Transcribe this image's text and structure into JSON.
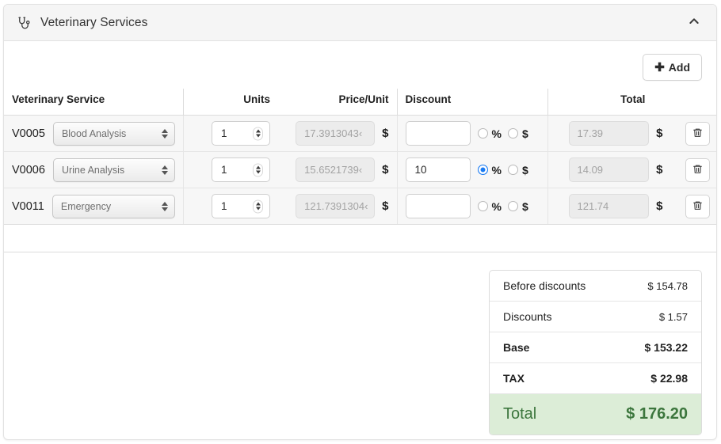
{
  "card": {
    "title": "Veterinary Services",
    "icon": "stethoscope-icon",
    "collapse_icon": "chevron-up-icon"
  },
  "toolbar": {
    "add_label": "Add",
    "add_icon": "plus-icon"
  },
  "table": {
    "headers": {
      "service": "Veterinary Service",
      "units": "Units",
      "price": "Price/Unit",
      "discount": "Discount",
      "total": "Total"
    },
    "currency_symbol": "$",
    "percent_symbol": "%",
    "delete_icon": "trash-icon",
    "rows": [
      {
        "code": "V0005",
        "service": "Blood Analysis",
        "units": "1",
        "price": "17.3913043478261",
        "price_display": "17.3913043‹",
        "discount_value": "",
        "discount_mode": "none",
        "total": "17.39"
      },
      {
        "code": "V0006",
        "service": "Urine Analysis",
        "units": "1",
        "price": "15.6521739130435",
        "price_display": "15.6521739‹",
        "discount_value": "10",
        "discount_mode": "percent",
        "total": "14.09"
      },
      {
        "code": "V0011",
        "service": "Emergency",
        "units": "1",
        "price": "121.739130434783",
        "price_display": "121.7391304‹",
        "discount_value": "",
        "discount_mode": "none",
        "total": "121.74"
      }
    ]
  },
  "summary": {
    "rows": [
      {
        "label": "Before discounts",
        "value": "$ 154.78",
        "strong": false
      },
      {
        "label": "Discounts",
        "value": "$ 1.57",
        "strong": false
      },
      {
        "label": "Base",
        "value": "$ 153.22",
        "strong": true
      },
      {
        "label": "TAX",
        "value": "$ 22.98",
        "strong": true
      }
    ],
    "grand": {
      "label": "Total",
      "value": "$ 176.20"
    }
  },
  "colors": {
    "accent_radio": "#1a7bf2",
    "total_bg": "#dcedd7",
    "total_text": "#3c763d",
    "header_bg": "#f5f5f5"
  }
}
